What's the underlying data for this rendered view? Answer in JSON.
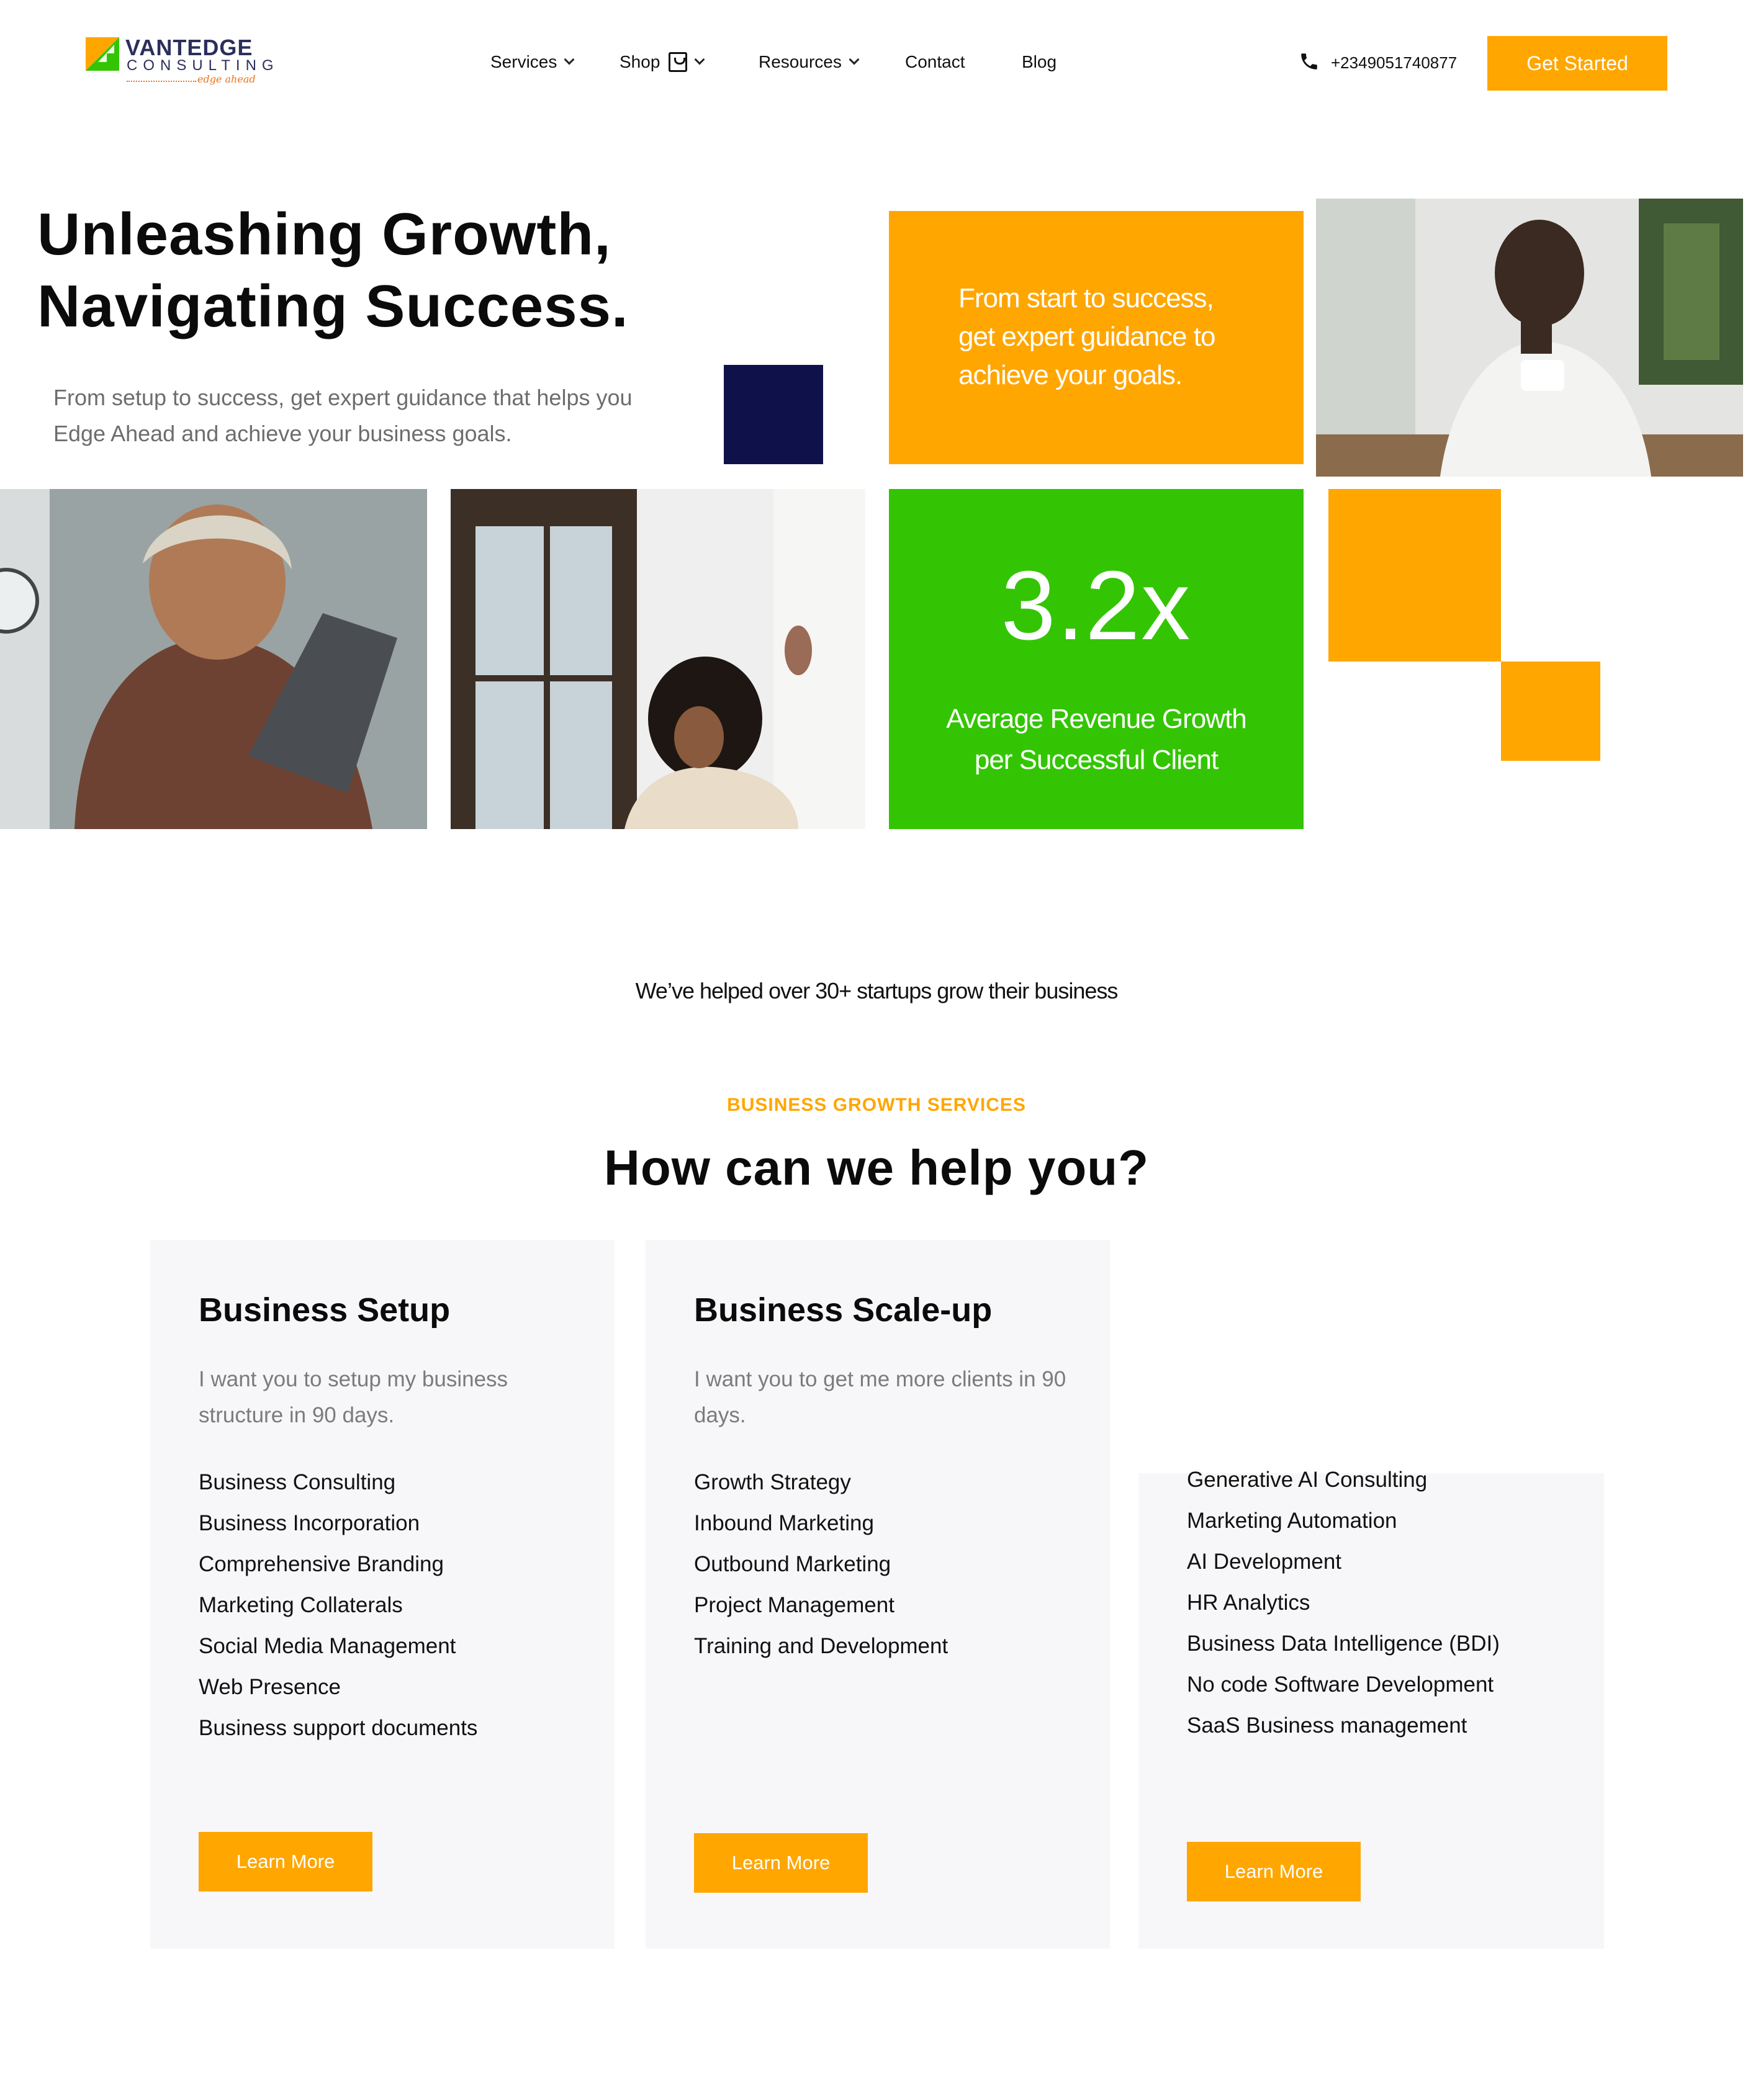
{
  "header": {
    "logo": {
      "name": "VANTEDGE",
      "sub": "CONSULTING",
      "tagline": "edge ahead"
    },
    "nav": [
      {
        "label": "Services"
      },
      {
        "label": "Shop"
      },
      {
        "label": "Resources"
      },
      {
        "label": "Contact"
      },
      {
        "label": "Blog"
      }
    ],
    "phone": "+2349051740877",
    "cta_label": "Get Started"
  },
  "hero": {
    "title_line1": "Unleashing Growth,",
    "title_line2": "Navigating Success.",
    "subtitle": "From setup to success, get expert guidance that helps you Edge Ahead and achieve your business goals.",
    "orange_card_text": "From start to success, get expert guidance to achieve your goals.",
    "stat_value": "3.2x",
    "stat_label": "Average Revenue Growth per Successful Client"
  },
  "social_proof": "We’ve helped over 30+ startups grow their business",
  "services": {
    "eyebrow": "BUSINESS GROWTH SERVICES",
    "title": "How can we help you?",
    "cards": [
      {
        "title": "Business Setup",
        "description": "I want you to setup my business structure in 90 days.",
        "items": [
          "Business Consulting",
          "Business Incorporation",
          "Comprehensive Branding",
          "Marketing Collaterals",
          "Social Media Management",
          "Web Presence",
          "Business support documents"
        ],
        "button": "Learn More"
      },
      {
        "title": "Business Scale-up",
        "description": "I want you to get me more clients in 90 days.",
        "items": [
          "Growth Strategy",
          "Inbound Marketing",
          "Outbound Marketing",
          "Project Management",
          "Training and Development"
        ],
        "button": "Learn More"
      },
      {
        "items": [
          "Generative AI Consulting",
          "Marketing Automation",
          "AI Development",
          "HR Analytics",
          "Business Data Intelligence (BDI)",
          "No code Software Development",
          "SaaS Business management"
        ],
        "button": "Learn More"
      }
    ]
  },
  "colors": {
    "accent": "#ffa600",
    "green": "#33c503",
    "navy": "#0f124a",
    "card_bg": "#f7f7f9"
  }
}
